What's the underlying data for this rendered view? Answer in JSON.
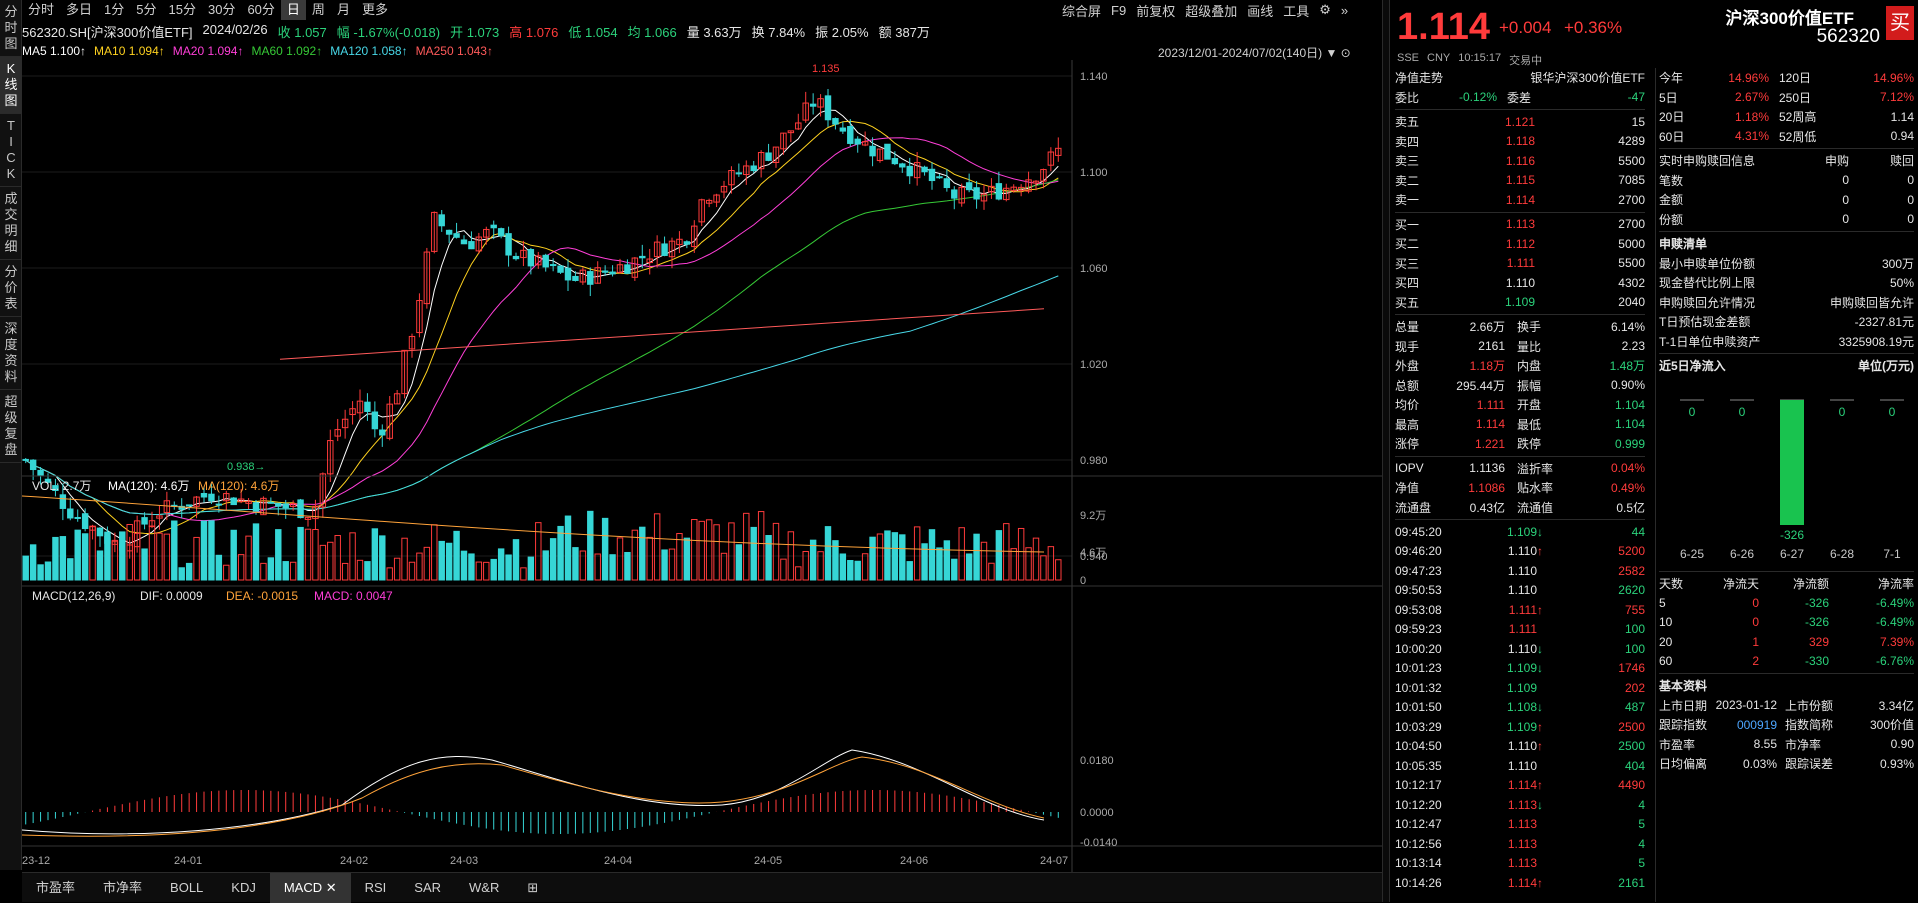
{
  "leftbar": [
    "分时图",
    "K线图",
    "TICK",
    "成交明细",
    "分价表",
    "深度资料",
    "超级复盘"
  ],
  "toptabs": [
    "分时",
    "多日",
    "1分",
    "5分",
    "15分",
    "30分",
    "60分",
    "日",
    "周",
    "月",
    "更多"
  ],
  "tools": [
    "综合屏",
    "F9",
    "前复权",
    "超级叠加",
    "画线",
    "工具"
  ],
  "info": {
    "code": "562320.SH[沪深300价值ETF]",
    "date": "2024/02/26",
    "close": "收 1.057",
    "amp": "幅 -1.67%(-0.018)",
    "open": "开 1.073",
    "high": "高 1.076",
    "low": "低 1.054",
    "avg": "均 1.066",
    "vol": "量 3.63万",
    "turn": "换 7.84%",
    "swing": "振 2.05%",
    "amt": "额 387万"
  },
  "ma": [
    {
      "t": "MA5 1.100↑",
      "c": "#ffffff"
    },
    {
      "t": "MA10 1.094↑",
      "c": "#ffd21f"
    },
    {
      "t": "MA20 1.094↑",
      "c": "#ff3fd8"
    },
    {
      "t": "MA60 1.092↑",
      "c": "#36c936"
    },
    {
      "t": "MA120 1.058↑",
      "c": "#48d8e8"
    },
    {
      "t": "MA250 1.043↑",
      "c": "#ff5a5a"
    }
  ],
  "daterange": "2023/12/01-2024/07/02(140日)",
  "price_axis": [
    "1.140",
    "1.100",
    "1.060",
    "1.020",
    "0.980",
    "0.940"
  ],
  "annot": {
    "high": "1.135",
    "low": "0.938"
  },
  "vol_header": {
    "vol": "VOL: 2.7万",
    "ma": "MA(120): 4.6万",
    "ma2": "MA(120): 4.6万"
  },
  "vol_axis": [
    "9.2万",
    "4.6万",
    "0"
  ],
  "macd_header": {
    "name": "MACD(12,26,9)",
    "dif": "DIF: 0.0009",
    "dea": "DEA: -0.0015",
    "macd": "MACD: 0.0047"
  },
  "macd_axis": [
    "0.0180",
    "0.0000",
    "-0.0140"
  ],
  "date_axis": [
    "23-12",
    "24-01",
    "24-02",
    "24-03",
    "24-04",
    "24-05",
    "24-06",
    "24-07"
  ],
  "bottomtabs": [
    "市盈率",
    "市净率",
    "BOLL",
    "KDJ",
    "MACD",
    "RSI",
    "SAR",
    "W&R"
  ],
  "chart_data": {
    "type": "candlestick",
    "title": "562320.SH 沪深300价值ETF 日K",
    "ylim": [
      0.93,
      1.145
    ],
    "high": 1.135,
    "low": 0.938,
    "current": 1.114,
    "ma": {
      "MA5": 1.1,
      "MA10": 1.094,
      "MA20": 1.094,
      "MA60": 1.092,
      "MA120": 1.058,
      "MA250": 1.043
    },
    "macd": {
      "dif": 0.0009,
      "dea": -0.0015,
      "macd": 0.0047
    },
    "volume_ma120": "4.6万"
  },
  "quote": {
    "price": "1.114",
    "chg": "+0.004",
    "pct": "+0.36%",
    "name": "沪深300价值ETF",
    "code": "562320",
    "mkt": "SSE",
    "cur": "CNY",
    "time": "10:15:17",
    "status": "交易中"
  },
  "nav": {
    "label": "净值走势",
    "fund": "银华沪深300价值ETF",
    "wb": "委比",
    "wb_v": "-0.12%",
    "wc": "委差",
    "wc_v": "-47"
  },
  "asks": [
    {
      "l": "卖五",
      "p": "1.121",
      "v": "15",
      "c": "red"
    },
    {
      "l": "卖四",
      "p": "1.118",
      "v": "4289",
      "c": "red"
    },
    {
      "l": "卖三",
      "p": "1.116",
      "v": "5500",
      "c": "red"
    },
    {
      "l": "卖二",
      "p": "1.115",
      "v": "7085",
      "c": "red"
    },
    {
      "l": "卖一",
      "p": "1.114",
      "v": "2700",
      "c": "red"
    }
  ],
  "bids": [
    {
      "l": "买一",
      "p": "1.113",
      "v": "2700",
      "c": "red"
    },
    {
      "l": "买二",
      "p": "1.112",
      "v": "5000",
      "c": "red"
    },
    {
      "l": "买三",
      "p": "1.111",
      "v": "5500",
      "c": "red"
    },
    {
      "l": "买四",
      "p": "1.110",
      "v": "4302",
      "c": "white"
    },
    {
      "l": "买五",
      "p": "1.109",
      "v": "2040",
      "c": "green"
    }
  ],
  "stats": [
    {
      "a": "总量",
      "av": "2.66万",
      "ac": "white",
      "b": "换手",
      "bv": "6.14%",
      "bc": "white"
    },
    {
      "a": "现手",
      "av": "2161",
      "ac": "white",
      "b": "量比",
      "bv": "2.23",
      "bc": "white"
    },
    {
      "a": "外盘",
      "av": "1.18万",
      "ac": "red",
      "b": "内盘",
      "bv": "1.48万",
      "bc": "green"
    },
    {
      "a": "总额",
      "av": "295.44万",
      "ac": "white",
      "b": "振幅",
      "bv": "0.90%",
      "bc": "white"
    },
    {
      "a": "均价",
      "av": "1.111",
      "ac": "red",
      "b": "开盘",
      "bv": "1.104",
      "bc": "green"
    },
    {
      "a": "最高",
      "av": "1.114",
      "ac": "red",
      "b": "最低",
      "bv": "1.104",
      "bc": "green"
    },
    {
      "a": "涨停",
      "av": "1.221",
      "ac": "red",
      "b": "跌停",
      "bv": "0.999",
      "bc": "green"
    }
  ],
  "iopv": [
    {
      "a": "IOPV",
      "av": "1.1136",
      "ac": "white",
      "b": "溢折率",
      "bv": "0.04%",
      "bc": "red"
    },
    {
      "a": "净值",
      "av": "1.1086",
      "ac": "red",
      "b": "贴水率",
      "bv": "0.49%",
      "bc": "red"
    },
    {
      "a": "流通盘",
      "av": "0.43亿",
      "ac": "white",
      "b": "流通值",
      "bv": "0.5亿",
      "bc": "white"
    }
  ],
  "ticks": [
    {
      "t": "09:45:20",
      "p": "1.109",
      "pc": "green",
      "a": "↓",
      "ac": "green",
      "v": "44",
      "vc": "green"
    },
    {
      "t": "09:46:20",
      "p": "1.110",
      "pc": "white",
      "a": "↑",
      "ac": "red",
      "v": "5200",
      "vc": "red"
    },
    {
      "t": "09:47:23",
      "p": "1.110",
      "pc": "white",
      "a": "",
      "ac": "",
      "v": "2582",
      "vc": "red"
    },
    {
      "t": "09:50:53",
      "p": "1.110",
      "pc": "white",
      "a": "",
      "ac": "",
      "v": "2620",
      "vc": "green"
    },
    {
      "t": "09:53:08",
      "p": "1.111",
      "pc": "red",
      "a": "↑",
      "ac": "red",
      "v": "755",
      "vc": "red"
    },
    {
      "t": "09:59:23",
      "p": "1.111",
      "pc": "red",
      "a": "",
      "ac": "",
      "v": "100",
      "vc": "green"
    },
    {
      "t": "10:00:20",
      "p": "1.110",
      "pc": "white",
      "a": "↓",
      "ac": "green",
      "v": "100",
      "vc": "green"
    },
    {
      "t": "10:01:23",
      "p": "1.109",
      "pc": "green",
      "a": "↓",
      "ac": "green",
      "v": "1746",
      "vc": "red"
    },
    {
      "t": "10:01:32",
      "p": "1.109",
      "pc": "green",
      "a": "",
      "ac": "",
      "v": "202",
      "vc": "red"
    },
    {
      "t": "10:01:50",
      "p": "1.108",
      "pc": "green",
      "a": "↓",
      "ac": "green",
      "v": "487",
      "vc": "green"
    },
    {
      "t": "10:03:29",
      "p": "1.109",
      "pc": "green",
      "a": "↑",
      "ac": "red",
      "v": "2500",
      "vc": "red"
    },
    {
      "t": "10:04:50",
      "p": "1.110",
      "pc": "white",
      "a": "↑",
      "ac": "red",
      "v": "2500",
      "vc": "green"
    },
    {
      "t": "10:05:35",
      "p": "1.110",
      "pc": "white",
      "a": "",
      "ac": "",
      "v": "404",
      "vc": "green"
    },
    {
      "t": "10:12:17",
      "p": "1.114",
      "pc": "red",
      "a": "↑",
      "ac": "red",
      "v": "4490",
      "vc": "red"
    },
    {
      "t": "10:12:20",
      "p": "1.113",
      "pc": "red",
      "a": "↓",
      "ac": "green",
      "v": "4",
      "vc": "green"
    },
    {
      "t": "10:12:47",
      "p": "1.113",
      "pc": "red",
      "a": "",
      "ac": "",
      "v": "5",
      "vc": "green"
    },
    {
      "t": "10:12:56",
      "p": "1.113",
      "pc": "red",
      "a": "",
      "ac": "",
      "v": "4",
      "vc": "green"
    },
    {
      "t": "10:13:14",
      "p": "1.113",
      "pc": "red",
      "a": "",
      "ac": "",
      "v": "5",
      "vc": "green"
    },
    {
      "t": "10:14:26",
      "p": "1.114",
      "pc": "red",
      "a": "↑",
      "ac": "red",
      "v": "2161",
      "vc": "green"
    }
  ],
  "perf": [
    {
      "a": "今年",
      "av": "14.96%",
      "b": "120日",
      "bv": "14.96%",
      "bc": "red"
    },
    {
      "a": "5日",
      "av": "2.67%",
      "b": "250日",
      "bv": "7.12%",
      "bc": "red"
    },
    {
      "a": "20日",
      "av": "1.18%",
      "b": "52周高",
      "bv": "1.14",
      "bc": "white"
    },
    {
      "a": "60日",
      "av": "4.31%",
      "b": "52周低",
      "bv": "0.94",
      "bc": "white"
    }
  ],
  "subs": {
    "title": "实时申购赎回信息",
    "c1": "申购",
    "c2": "赎回",
    "rows": [
      {
        "l": "笔数",
        "a": "0",
        "b": "0"
      },
      {
        "l": "金额",
        "a": "0",
        "b": "0"
      },
      {
        "l": "份额",
        "a": "0",
        "b": "0"
      }
    ]
  },
  "purchase": {
    "title": "申赎清单",
    "rows": [
      {
        "l": "最小申赎单位份额",
        "v": "300万"
      },
      {
        "l": "现金替代比例上限",
        "v": "50%"
      },
      {
        "l": "申购赎回允许情况",
        "v": "申购赎回皆允许"
      },
      {
        "l": "T日预估现金差额",
        "v": "-2327.81元"
      },
      {
        "l": "T-1日单位申赎资产",
        "v": "3325908.19元"
      }
    ]
  },
  "flow": {
    "title": "近5日净流入",
    "unit": "单位(万元)",
    "dates": [
      "6-25",
      "6-26",
      "6-27",
      "6-28",
      "7-1"
    ],
    "values": [
      0,
      0,
      -326,
      0,
      0
    ],
    "labels": [
      "0",
      "0",
      "-326",
      "0",
      "0"
    ]
  },
  "flow_table": {
    "headers": [
      "天数",
      "净流天",
      "净流额",
      "净流率"
    ],
    "rows": [
      {
        "d": "5",
        "n": "0",
        "a": "-326",
        "r": "-6.49%",
        "nc": "red",
        "ac": "green",
        "rc": "green"
      },
      {
        "d": "10",
        "n": "0",
        "a": "-326",
        "r": "-6.49%",
        "nc": "red",
        "ac": "green",
        "rc": "green"
      },
      {
        "d": "20",
        "n": "1",
        "a": "329",
        "r": "7.39%",
        "nc": "red",
        "ac": "red",
        "rc": "red"
      },
      {
        "d": "60",
        "n": "2",
        "a": "-330",
        "r": "-6.76%",
        "nc": "red",
        "ac": "green",
        "rc": "green"
      }
    ]
  },
  "basic": {
    "title": "基本资料",
    "rows": [
      {
        "a": "上市日期",
        "av": "2023-01-12",
        "ac": "white",
        "b": "上市份额",
        "bv": "3.34亿",
        "bc": "white"
      },
      {
        "a": "跟踪指数",
        "av": "000919",
        "ac": "blue",
        "b": "指数简称",
        "bv": "300价值",
        "bc": "white"
      },
      {
        "a": "市盈率",
        "av": "8.55",
        "ac": "white",
        "b": "市净率",
        "bv": "0.90",
        "bc": "white"
      },
      {
        "a": "日均偏离",
        "av": "0.03%",
        "ac": "white",
        "b": "跟踪误差",
        "bv": "0.93%",
        "bc": "white"
      }
    ]
  }
}
